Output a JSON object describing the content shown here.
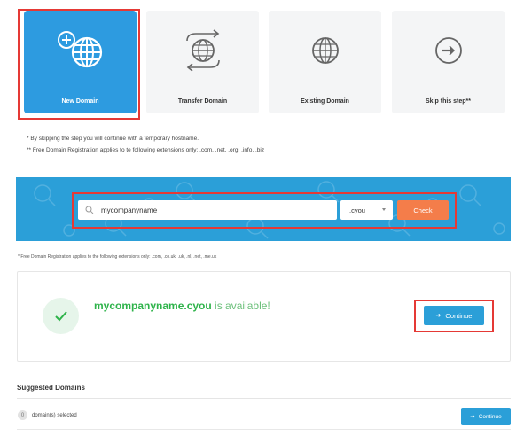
{
  "options": [
    {
      "label": "New Domain",
      "icon": "globe-plus-icon",
      "selected": true
    },
    {
      "label": "Transfer Domain",
      "icon": "globe-transfer-icon",
      "selected": false
    },
    {
      "label": "Existing Domain",
      "icon": "globe-icon",
      "selected": false
    },
    {
      "label": "Skip this step**",
      "icon": "arrow-right-circle-icon",
      "selected": false
    }
  ],
  "notes": {
    "skip": "* By skipping the step you will continue with a temporary hostname.",
    "free": "** Free Domain Registration applies to te following extensions only: .com, .net, .org, .info, .biz"
  },
  "search": {
    "value": "mycompanyname",
    "tld": ".cyou",
    "check_label": "Check"
  },
  "band_note": "* Free Domain Registration applies to the following extensions only: .com, .co.uk, .uk, .nl, .net, .me.uk",
  "result": {
    "domain": "mycompanyname.cyou",
    "status_text": " is available!",
    "continue_label": "Continue"
  },
  "suggested": {
    "title": "Suggested Domains",
    "count": "0",
    "selected_text": "domain(s) selected",
    "continue_label": "Continue"
  },
  "colors": {
    "brand_blue": "#2b9fd8",
    "check_orange": "#f47d4a",
    "available_green": "#2eb34a",
    "highlight_red": "#e53935"
  }
}
